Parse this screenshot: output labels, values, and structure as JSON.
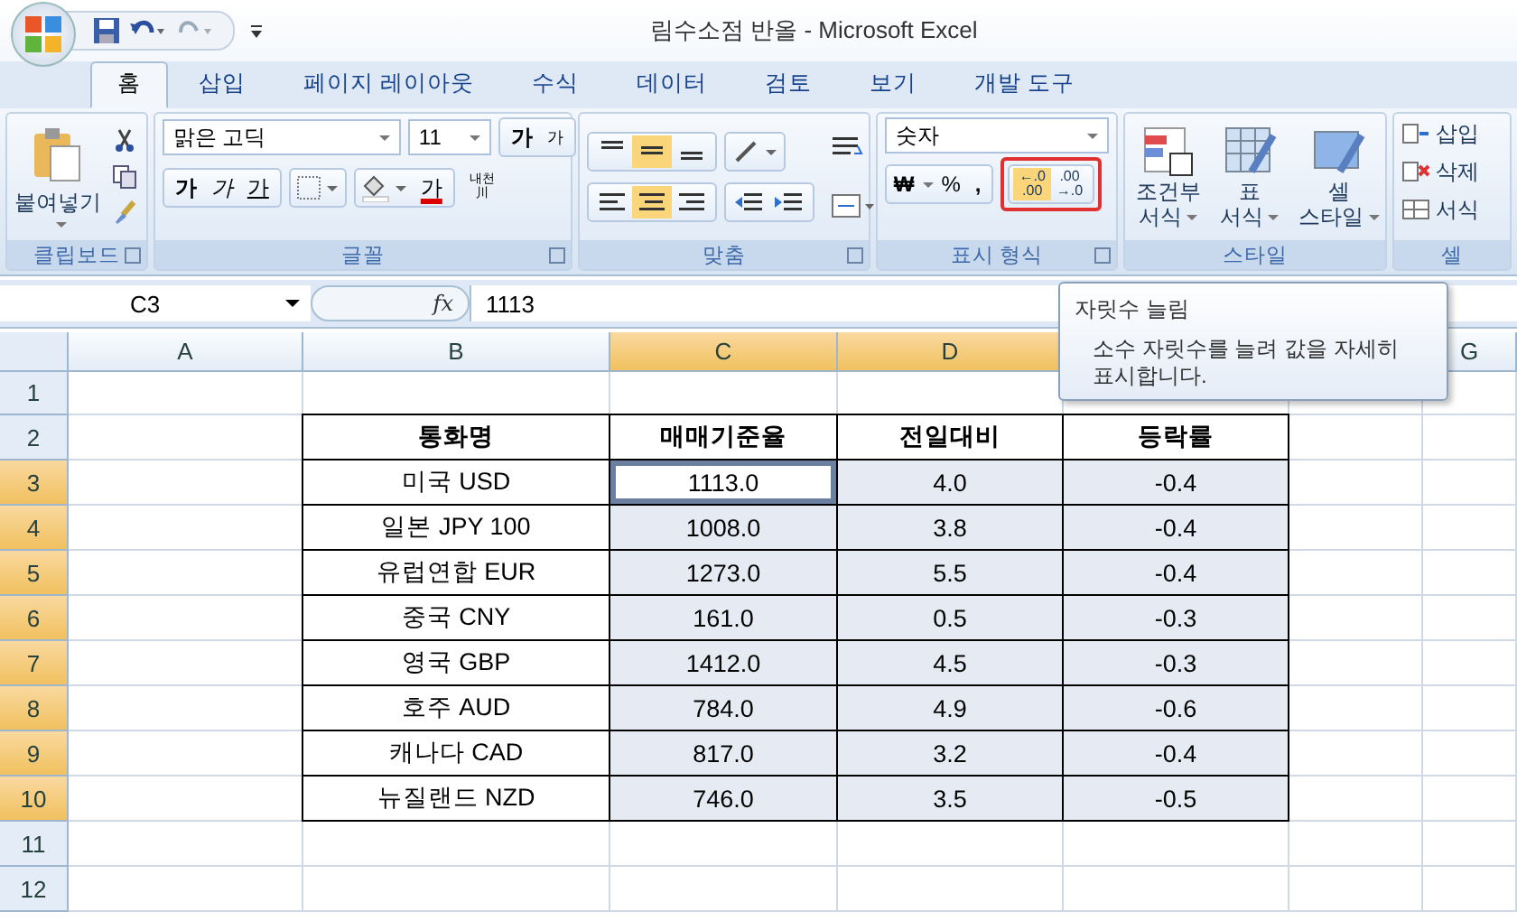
{
  "window": {
    "title": "림수소점 반올 - Microsoft Excel"
  },
  "tabs": [
    {
      "label": "홈",
      "selected": true
    },
    {
      "label": "삽입",
      "selected": false
    },
    {
      "label": "페이지 레이아웃",
      "selected": false
    },
    {
      "label": "수식",
      "selected": false
    },
    {
      "label": "데이터",
      "selected": false
    },
    {
      "label": "검토",
      "selected": false
    },
    {
      "label": "보기",
      "selected": false
    },
    {
      "label": "개발 도구",
      "selected": false
    }
  ],
  "ribbon": {
    "clipboard": {
      "label": "클립보드",
      "paste": "붙여넣기"
    },
    "font": {
      "label": "글꼴",
      "font_name": "맑은 고딕",
      "font_size": "11",
      "grow": "가",
      "shrink": "가",
      "bold": "가",
      "italic": "가",
      "underline": "가",
      "font_color": "가",
      "phonetic_top": "내천",
      "phonetic_bottom": "川"
    },
    "alignment": {
      "label": "맞춤"
    },
    "number": {
      "label": "표시 형식",
      "format": "숫자",
      "currency": "₩",
      "percent": "%",
      "comma": ",",
      "highlighted": true,
      "decimals": [
        {
          "top": "←.0",
          "bottom": ".00",
          "hovered": true
        },
        {
          "top": ".00",
          "bottom": "→.0",
          "hovered": false
        }
      ]
    },
    "styles": {
      "label": "스타일",
      "buttons": [
        {
          "kind": "conditional",
          "line1": "조건부",
          "line2": "서식"
        },
        {
          "kind": "table",
          "line1": "표",
          "line2": "서식"
        },
        {
          "kind": "cell",
          "line1": "셀",
          "line2": "스타일"
        }
      ]
    },
    "cells": {
      "label": "셀",
      "buttons": [
        {
          "kind": "insert",
          "label": "삽입"
        },
        {
          "kind": "delete",
          "label": "삭제"
        },
        {
          "kind": "format",
          "label": "서식"
        }
      ]
    }
  },
  "formula_bar": {
    "name_box": "C3",
    "fx": "fx",
    "value": "1113"
  },
  "tooltip": {
    "title": "자릿수 늘림",
    "lines": [
      "소수 자릿수를 늘려 값을 자세히",
      "표시합니다."
    ]
  },
  "sheet": {
    "columns": [
      {
        "label": "A",
        "selected": false
      },
      {
        "label": "B",
        "selected": false
      },
      {
        "label": "C",
        "selected": true
      },
      {
        "label": "D",
        "selected": true
      },
      {
        "label": "G",
        "selected": false
      }
    ],
    "rows": [
      {
        "label": "1",
        "selected": false
      },
      {
        "label": "2",
        "selected": false
      },
      {
        "label": "3",
        "selected": true
      },
      {
        "label": "4",
        "selected": true
      },
      {
        "label": "5",
        "selected": true
      },
      {
        "label": "6",
        "selected": true
      },
      {
        "label": "7",
        "selected": true
      },
      {
        "label": "8",
        "selected": true
      },
      {
        "label": "9",
        "selected": true
      },
      {
        "label": "10",
        "selected": true
      },
      {
        "label": "11",
        "selected": false
      },
      {
        "label": "12",
        "selected": false
      }
    ]
  },
  "table": {
    "header": [
      "통화명",
      "매매기준율",
      "전일대비",
      "등락률"
    ],
    "rows": [
      {
        "name": "미국 USD",
        "values": [
          {
            "text": "1113.0",
            "selected": true,
            "active": true
          },
          {
            "text": "4.0",
            "selected": true,
            "active": false
          },
          {
            "text": "-0.4",
            "selected": true,
            "active": false
          }
        ]
      },
      {
        "name": "일본 JPY 100",
        "values": [
          {
            "text": "1008.0",
            "selected": true,
            "active": false
          },
          {
            "text": "3.8",
            "selected": true,
            "active": false
          },
          {
            "text": "-0.4",
            "selected": true,
            "active": false
          }
        ]
      },
      {
        "name": "유럽연합 EUR",
        "values": [
          {
            "text": "1273.0",
            "selected": true,
            "active": false
          },
          {
            "text": "5.5",
            "selected": true,
            "active": false
          },
          {
            "text": "-0.4",
            "selected": true,
            "active": false
          }
        ]
      },
      {
        "name": "중국 CNY",
        "values": [
          {
            "text": "161.0",
            "selected": true,
            "active": false
          },
          {
            "text": "0.5",
            "selected": true,
            "active": false
          },
          {
            "text": "-0.3",
            "selected": true,
            "active": false
          }
        ]
      },
      {
        "name": "영국 GBP",
        "values": [
          {
            "text": "1412.0",
            "selected": true,
            "active": false
          },
          {
            "text": "4.5",
            "selected": true,
            "active": false
          },
          {
            "text": "-0.3",
            "selected": true,
            "active": false
          }
        ]
      },
      {
        "name": "호주 AUD",
        "values": [
          {
            "text": "784.0",
            "selected": true,
            "active": false
          },
          {
            "text": "4.9",
            "selected": true,
            "active": false
          },
          {
            "text": "-0.6",
            "selected": true,
            "active": false
          }
        ]
      },
      {
        "name": "캐나다 CAD",
        "values": [
          {
            "text": "817.0",
            "selected": true,
            "active": false
          },
          {
            "text": "3.2",
            "selected": true,
            "active": false
          },
          {
            "text": "-0.4",
            "selected": true,
            "active": false
          }
        ]
      },
      {
        "name": "뉴질랜드 NZD",
        "values": [
          {
            "text": "746.0",
            "selected": true,
            "active": false
          },
          {
            "text": "3.5",
            "selected": true,
            "active": false
          },
          {
            "text": "-0.5",
            "selected": true,
            "active": false
          }
        ]
      }
    ]
  }
}
